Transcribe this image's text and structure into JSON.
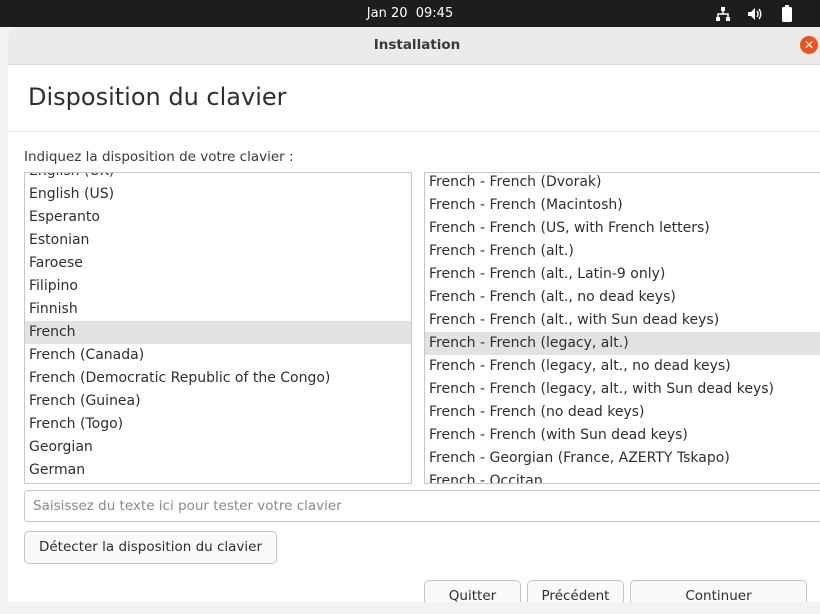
{
  "system_bar": {
    "date": "Jan 20",
    "time": "09:45",
    "icons": [
      "network-icon",
      "volume-icon",
      "battery-icon"
    ]
  },
  "window": {
    "title": "Installation",
    "close_icon": "close-icon",
    "accent_color": "#e95420"
  },
  "page": {
    "heading": "Disposition du clavier",
    "prompt": "Indiquez la disposition de votre clavier :"
  },
  "layouts": {
    "items": [
      "English (UK)",
      "English (US)",
      "Esperanto",
      "Estonian",
      "Faroese",
      "Filipino",
      "Finnish",
      "French",
      "French (Canada)",
      "French (Democratic Republic of the Congo)",
      "French (Guinea)",
      "French (Togo)",
      "Georgian",
      "German"
    ],
    "selected": "French"
  },
  "variants": {
    "items": [
      "French - French (Dvorak)",
      "French - French (Macintosh)",
      "French - French (US, with French letters)",
      "French - French (alt.)",
      "French - French (alt., Latin-9 only)",
      "French - French (alt., no dead keys)",
      "French - French (alt., with Sun dead keys)",
      "French - French (legacy, alt.)",
      "French - French (legacy, alt., no dead keys)",
      "French - French (legacy, alt., with Sun dead keys)",
      "French - French (no dead keys)",
      "French - French (with Sun dead keys)",
      "French - Georgian (France, AZERTY Tskapo)",
      "French - Occitan"
    ],
    "selected": "French - French (legacy, alt.)"
  },
  "test_input": {
    "value": "",
    "placeholder": "Saisissez du texte ici pour tester votre clavier"
  },
  "buttons": {
    "detect": "Détecter la disposition du clavier",
    "quit": "Quitter",
    "previous": "Précédent",
    "continue": "Continuer"
  }
}
